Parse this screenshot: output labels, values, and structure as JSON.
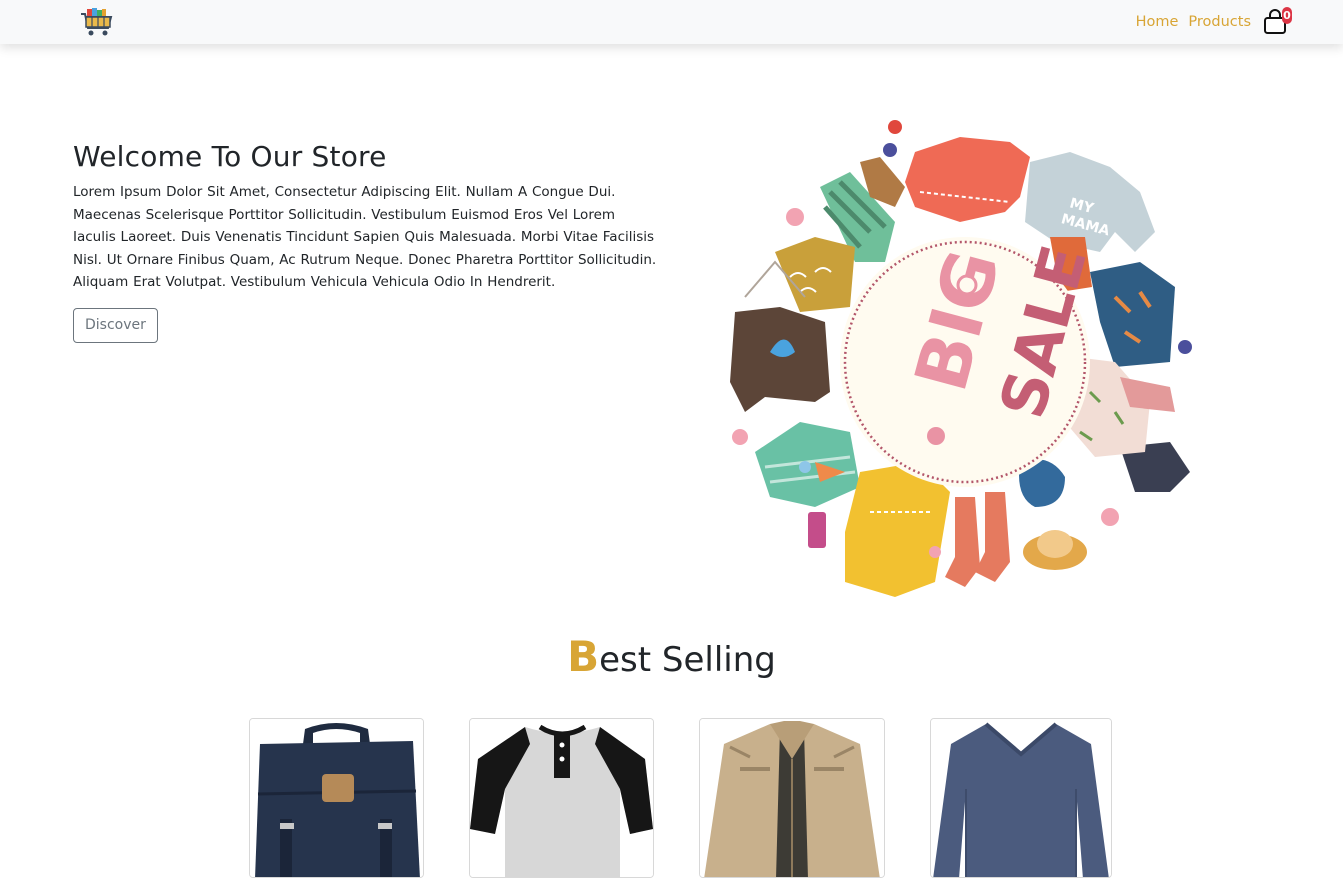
{
  "nav": {
    "home": "Home",
    "products": "Products",
    "cart_count": "0"
  },
  "hero": {
    "title": "Welcome To Our Store",
    "paragraph": "Lorem Ipsum Dolor Sit Amet, Consectetur Adipiscing Elit. Nullam A Congue Dui. Maecenas Scelerisque Porttitor Sollicitudin. Vestibulum Euismod Eros Vel Lorem Iaculis Laoreet. Duis Venenatis Tincidunt Sapien Quis Malesuada. Morbi Vitae Facilisis Nisl. Ut Ornare Finibus Quam, Ac Rutrum Neque. Donec Pharetra Porttitor Sollicitudin. Aliquam Erat Volutpat. Vestibulum Vehicula Vehicula Odio In Hendrerit.",
    "button": "Discover",
    "sale_word_1": "BIG",
    "sale_word_2": "SALE",
    "sweater_text_1": "MY",
    "sweater_text_2": "MAMA"
  },
  "best_selling": {
    "first_letter": "B",
    "rest": "est Selling",
    "products": [
      {
        "name": "backpack",
        "color": "#26344d"
      },
      {
        "name": "raglan-shirt",
        "color": "#1a1a1a"
      },
      {
        "name": "jacket",
        "color": "#c8b08c"
      },
      {
        "name": "long-sleeve-shirt",
        "color": "#4b5b7e"
      }
    ]
  },
  "colors": {
    "accent": "#d8a535",
    "badge": "#dc3545"
  }
}
